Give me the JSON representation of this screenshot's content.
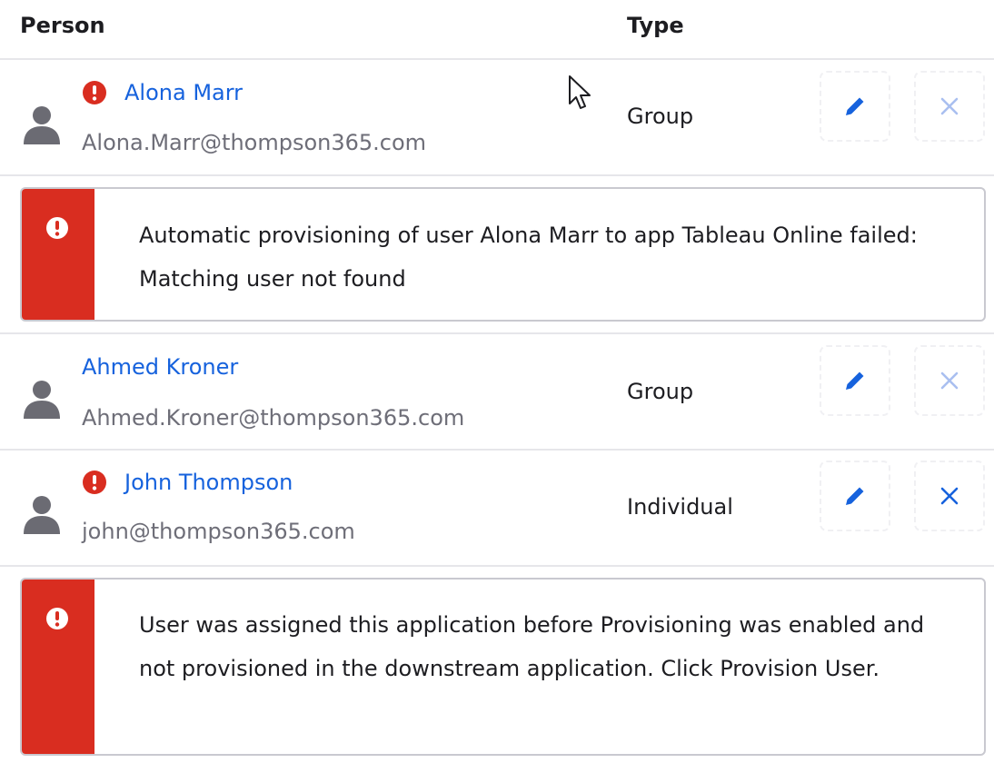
{
  "header": {
    "person_label": "Person",
    "type_label": "Type"
  },
  "rows": [
    {
      "name": "Alona Marr",
      "email": "Alona.Marr@thompson365.com",
      "type": "Group",
      "has_error": true
    },
    {
      "name": "Ahmed Kroner",
      "email": "Ahmed.Kroner@thompson365.com",
      "type": "Group",
      "has_error": false
    },
    {
      "name": "John Thompson",
      "email": "john@thompson365.com",
      "type": "Individual",
      "has_error": true
    }
  ],
  "errors": [
    "Automatic provisioning of user Alona Marr to app Tableau Online failed: Matching user not found",
    "User was assigned this application before Provisioning was enabled and not provisioned in the downstream application. Click Provision User."
  ],
  "icons": {
    "avatar": "person-icon",
    "alert": "error-icon",
    "edit": "pencil-icon",
    "remove": "close-icon"
  },
  "colors": {
    "link": "#1662dd",
    "error": "#d92d20",
    "edit_icon": "#1662dd",
    "remove_icon_muted": "#a9bff0",
    "remove_icon_active": "#1662dd"
  }
}
